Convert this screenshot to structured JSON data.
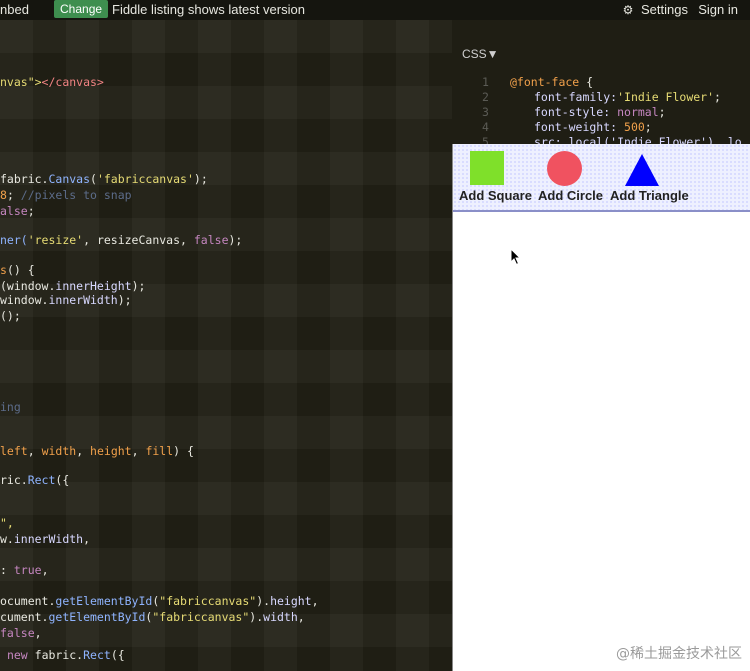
{
  "topbar": {
    "left_text": "nbed",
    "change_label": "Change",
    "message": "Fiddle listing shows latest version",
    "settings_label": "Settings",
    "signin_label": "Sign in"
  },
  "code_lines": [
    {
      "parts": [
        {
          "t": "nvas\">",
          "c": "c-str"
        },
        {
          "t": "</canvas>",
          "c": "c-tag"
        }
      ]
    },
    {
      "parts": [
        {
          "t": "fabric.",
          "c": "c-w"
        },
        {
          "t": "Canvas",
          "c": "c-fn"
        },
        {
          "t": "(",
          "c": "c-w"
        },
        {
          "t": "'fabriccanvas'",
          "c": "c-str"
        },
        {
          "t": ");",
          "c": "c-w"
        }
      ]
    },
    {
      "parts": [
        {
          "t": "8",
          "c": "c-o"
        },
        {
          "t": "; ",
          "c": "c-w"
        },
        {
          "t": "//pixels to snap",
          "c": "c-com"
        }
      ]
    },
    {
      "parts": [
        {
          "t": "alse",
          "c": "c-kw"
        },
        {
          "t": ";",
          "c": "c-w"
        }
      ]
    },
    {
      "parts": [
        {
          "t": "ner(",
          "c": "c-fn"
        },
        {
          "t": "'resize'",
          "c": "c-str"
        },
        {
          "t": ", resizeCanvas, ",
          "c": "c-w"
        },
        {
          "t": "false",
          "c": "c-kw"
        },
        {
          "t": ");",
          "c": "c-w"
        }
      ]
    },
    {
      "parts": [
        {
          "t": "s",
          "c": "c-o"
        },
        {
          "t": "() {",
          "c": "c-w"
        }
      ]
    },
    {
      "parts": [
        {
          "t": "(window.",
          "c": "c-w"
        },
        {
          "t": "innerHeight",
          "c": "c-b"
        },
        {
          "t": ");",
          "c": "c-w"
        }
      ]
    },
    {
      "parts": [
        {
          "t": "window.",
          "c": "c-w"
        },
        {
          "t": "innerWidth",
          "c": "c-b"
        },
        {
          "t": ");",
          "c": "c-w"
        }
      ]
    },
    {
      "parts": [
        {
          "t": "();",
          "c": "c-w"
        }
      ]
    },
    {
      "parts": [
        {
          "t": "ing",
          "c": "c-com"
        }
      ]
    },
    {
      "parts": [
        {
          "t": "left",
          "c": "c-o"
        },
        {
          "t": ", ",
          "c": "c-w"
        },
        {
          "t": "width",
          "c": "c-o"
        },
        {
          "t": ", ",
          "c": "c-w"
        },
        {
          "t": "height",
          "c": "c-o"
        },
        {
          "t": ", ",
          "c": "c-w"
        },
        {
          "t": "fill",
          "c": "c-o"
        },
        {
          "t": ") {",
          "c": "c-w"
        }
      ]
    },
    {
      "parts": [
        {
          "t": "ric.",
          "c": "c-w"
        },
        {
          "t": "Rect",
          "c": "c-fn"
        },
        {
          "t": "({",
          "c": "c-w"
        }
      ]
    },
    {
      "parts": [
        {
          "t": "\",",
          "c": "c-str"
        }
      ]
    },
    {
      "parts": [
        {
          "t": "w.",
          "c": "c-w"
        },
        {
          "t": "innerWidth",
          "c": "c-b"
        },
        {
          "t": ",",
          "c": "c-w"
        }
      ]
    },
    {
      "parts": [
        {
          "t": ": ",
          "c": "c-w"
        },
        {
          "t": "true",
          "c": "c-kw"
        },
        {
          "t": ",",
          "c": "c-w"
        }
      ]
    },
    {
      "parts": [
        {
          "t": "ocument.",
          "c": "c-w"
        },
        {
          "t": "getElementById",
          "c": "c-fn"
        },
        {
          "t": "(",
          "c": "c-w"
        },
        {
          "t": "\"fabriccanvas\"",
          "c": "c-str"
        },
        {
          "t": ").",
          "c": "c-w"
        },
        {
          "t": "height",
          "c": "c-b"
        },
        {
          "t": ",",
          "c": "c-w"
        }
      ]
    },
    {
      "parts": [
        {
          "t": "cument.",
          "c": "c-w"
        },
        {
          "t": "getElementById",
          "c": "c-fn"
        },
        {
          "t": "(",
          "c": "c-w"
        },
        {
          "t": "\"fabriccanvas\"",
          "c": "c-str"
        },
        {
          "t": ").",
          "c": "c-w"
        },
        {
          "t": "width",
          "c": "c-b"
        },
        {
          "t": ",",
          "c": "c-w"
        }
      ]
    },
    {
      "parts": [
        {
          "t": "false",
          "c": "c-kw"
        },
        {
          "t": ",",
          "c": "c-w"
        }
      ]
    },
    {
      "parts": [
        {
          "t": " ",
          "c": "c-w"
        },
        {
          "t": "new ",
          "c": "c-kw"
        },
        {
          "t": "fabric.",
          "c": "c-w"
        },
        {
          "t": "Rect",
          "c": "c-fn"
        },
        {
          "t": "({",
          "c": "c-w"
        }
      ]
    }
  ],
  "css_panel": {
    "tab_label": "CSS▼",
    "lines": [
      {
        "parts": [
          {
            "t": "@font-face",
            "c": "c-o"
          },
          {
            "t": " {",
            "c": "c-w"
          }
        ]
      },
      {
        "parts": [
          {
            "t": "font-family:",
            "c": "c-b"
          },
          {
            "t": "'Indie Flower'",
            "c": "c-str"
          },
          {
            "t": ";",
            "c": "c-w"
          }
        ]
      },
      {
        "parts": [
          {
            "t": "font-style: ",
            "c": "c-b"
          },
          {
            "t": "normal",
            "c": "c-kw"
          },
          {
            "t": ";",
            "c": "c-w"
          }
        ]
      },
      {
        "parts": [
          {
            "t": "font-weight: ",
            "c": "c-b"
          },
          {
            "t": "500",
            "c": "c-o"
          },
          {
            "t": ";",
            "c": "c-w"
          }
        ]
      },
      {
        "parts": [
          {
            "t": "src: local('Indie Flower'), lo",
            "c": "c-b"
          }
        ]
      }
    ],
    "line_numbers": [
      "1",
      "2",
      "3",
      "4",
      "5"
    ]
  },
  "result": {
    "tools": [
      {
        "label": "Add Square"
      },
      {
        "label": "Add Circle"
      },
      {
        "label": "Add Triangle"
      }
    ]
  },
  "colors": {
    "square": "#7fe02a",
    "circle": "#f05260",
    "triangle": "#0000ff",
    "change_button": "#3e8e4f"
  },
  "watermark": "@稀土掘金技术社区"
}
